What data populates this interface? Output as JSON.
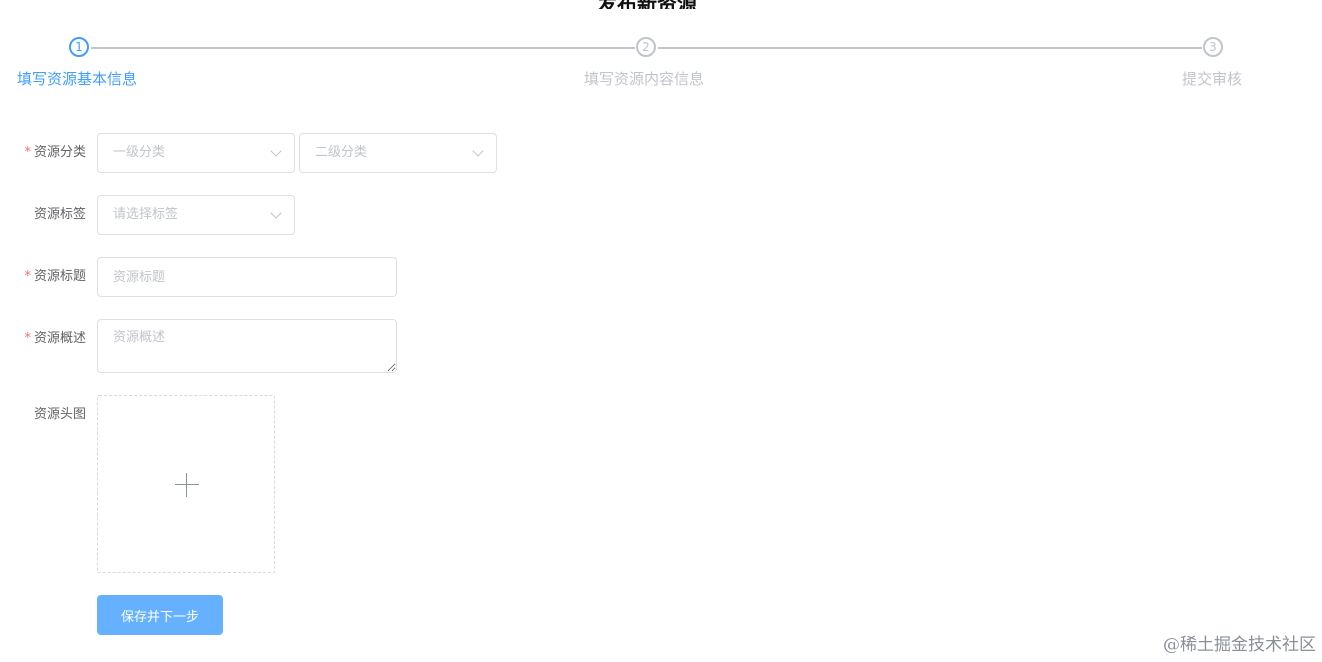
{
  "page": {
    "title": "发布新资源"
  },
  "steps": [
    {
      "number": "1",
      "title": "填写资源基本信息",
      "status": "active"
    },
    {
      "number": "2",
      "title": "填写资源内容信息",
      "status": "wait"
    },
    {
      "number": "3",
      "title": "提交审核",
      "status": "wait"
    }
  ],
  "form": {
    "category": {
      "label": "资源分类",
      "required": true,
      "primary_placeholder": "一级分类",
      "secondary_placeholder": "二级分类"
    },
    "tags": {
      "label": "资源标签",
      "required": false,
      "placeholder": "请选择标签"
    },
    "title": {
      "label": "资源标题",
      "required": true,
      "placeholder": "资源标题",
      "value": ""
    },
    "summary": {
      "label": "资源概述",
      "required": true,
      "placeholder": "资源概述",
      "value": ""
    },
    "cover": {
      "label": "资源头图",
      "required": false
    }
  },
  "actions": {
    "submit_label": "保存并下一步"
  },
  "required_mark": "*",
  "watermark": "@稀土掘金技术社区",
  "colors": {
    "primary": "#409eff",
    "button": "#66b1ff",
    "required": "#f56c6c",
    "inactive": "#c0c4cc"
  },
  "icons": {
    "select_arrow": "chevron-down-icon",
    "upload": "plus-icon"
  }
}
